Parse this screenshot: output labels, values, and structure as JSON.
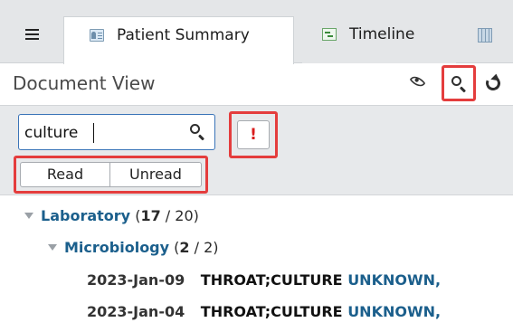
{
  "tabs": [
    {
      "label": "Patient Summary",
      "icon": "patient-summary-icon",
      "active": true
    },
    {
      "label": "Timeline",
      "icon": "timeline-icon",
      "active": false
    },
    {
      "label": "",
      "icon": "grid-icon",
      "active": false
    }
  ],
  "document_view": {
    "title": "Document View",
    "header_icons": [
      "eye-icon",
      "search-icon",
      "refresh-icon"
    ]
  },
  "filter": {
    "search_value": "culture",
    "alert_symbol": "!",
    "read_label": "Read",
    "unread_label": "Unread"
  },
  "tree": {
    "laboratory": {
      "name": "Laboratory",
      "unread": "17",
      "total": "20"
    },
    "microbiology": {
      "name": "Microbiology",
      "unread": "2",
      "total": "2"
    },
    "documents": [
      {
        "date": "2023-Jan-09",
        "name": "THROAT;CULTURE",
        "status": "UNKNOWN,"
      },
      {
        "date": "2023-Jan-04",
        "name": "THROAT;CULTURE",
        "status": "UNKNOWN,"
      }
    ]
  },
  "colors": {
    "highlight": "#e43d3d",
    "category": "#1b5f8c",
    "tab_bar": "#e4e6e8",
    "filter_panel": "#e7e9eb",
    "alert": "#d91c1c"
  }
}
